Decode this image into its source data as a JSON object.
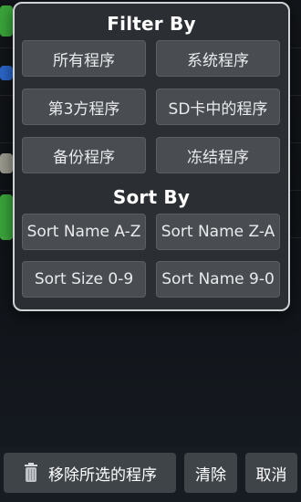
{
  "dialog": {
    "filter_title": "Filter By",
    "filter_buttons": [
      "所有程序",
      "系统程序",
      "第3方程序",
      "SD卡中的程序",
      "备份程序",
      "冻结程序"
    ],
    "sort_title": "Sort By",
    "sort_buttons": [
      "Sort Name A-Z",
      "Sort Name Z-A",
      "Sort Size 0-9",
      "Sort Name 9-0"
    ]
  },
  "bottom_bar": {
    "remove_label": "移除所选的程序",
    "clear_label": "清除",
    "cancel_label": "取消",
    "remove_icon": "trash-icon"
  },
  "colors": {
    "panel_bg": "#2b2f33",
    "panel_border": "#cfd3d6",
    "button_bg": "#494d52",
    "bottom_button_bg": "#3f4448",
    "text": "#ffffff"
  }
}
